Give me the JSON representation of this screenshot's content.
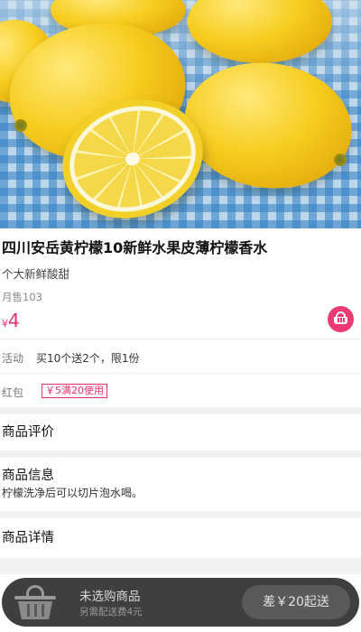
{
  "product": {
    "title": "四川安岳黄柠檬10新鲜水果皮薄柠檬香水",
    "subtitle": "个大新鲜酸甜",
    "sales": "月售103",
    "price_symbol": "¥",
    "price": "4"
  },
  "promo": {
    "activity_label": "活动",
    "activity_text": "买10个送2个，限1份",
    "redpacket_label": "红包",
    "redpacket_coupon": "￥5满20使用"
  },
  "sections": {
    "reviews_title": "商品评价",
    "info_title": "商品信息",
    "info_text": "柠檬洗净后可以切片泡水喝。",
    "details_title": "商品详情"
  },
  "cart_bar": {
    "status": "未选购商品",
    "delivery_fee": "另需配送费4元",
    "checkout_label": "差￥20起送"
  },
  "icons": {
    "cart_button": "shopping-basket-icon",
    "cart_bar": "basket-icon"
  },
  "colors": {
    "accent": "#e8316a",
    "cart_button": "#ee3a73",
    "bar_bg": "#3f3f3f"
  }
}
